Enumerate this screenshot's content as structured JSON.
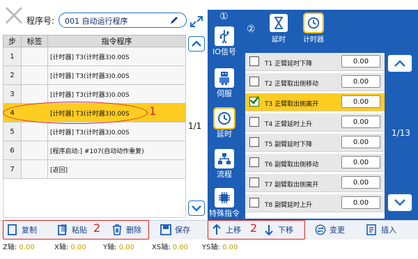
{
  "header": {
    "program_label": "程序号:",
    "program_value": "001 自动运行程序"
  },
  "program_table": {
    "columns": [
      "步",
      "标签",
      "指令程序"
    ],
    "rows": [
      {
        "step": "1",
        "tag": "",
        "instruction": "[计时器] T3(计时器3)0.00S"
      },
      {
        "step": "2",
        "tag": "",
        "instruction": "[计时器] T3(计时器3)0.00S"
      },
      {
        "step": "3",
        "tag": "",
        "instruction": "[计时器] T3(计时器3)0.00S"
      },
      {
        "step": "4",
        "tag": "",
        "instruction": "[计时器] T3(计时器3)0.00S"
      },
      {
        "step": "5",
        "tag": "",
        "instruction": "[计时器] T3(计时器3)0.00S"
      },
      {
        "step": "6",
        "tag": "",
        "instruction": "[程序启动:] #107(自动动作重复)"
      },
      {
        "step": "7",
        "tag": "",
        "instruction": "[返回]"
      }
    ],
    "selected_step": "4",
    "page_indicator": "1/1"
  },
  "annotations": {
    "circle1": "①",
    "circle2": "②",
    "marker_row": "1",
    "marker_toolbar_left": "2",
    "marker_toolbar_mid": "2"
  },
  "categories": [
    {
      "label": "IO信号",
      "icon": "usb-icon"
    },
    {
      "label": "伺服",
      "icon": "robot-icon"
    },
    {
      "label": "延时",
      "icon": "clock-icon"
    },
    {
      "label": "流程",
      "icon": "flow-icon"
    },
    {
      "label": "特殊指令",
      "icon": "chip-icon"
    }
  ],
  "sub_tabs": [
    {
      "label": "延时",
      "icon": "hourglass-icon"
    },
    {
      "label": "计时器",
      "icon": "clock-icon"
    }
  ],
  "timers": [
    {
      "label": "T1  正臂延时下降",
      "value": "0.00",
      "checked": false
    },
    {
      "label": "T2  正臂取出侧移动",
      "value": "0.00",
      "checked": false
    },
    {
      "label": "T3  正臂取出侧离开",
      "value": "0.00",
      "checked": true
    },
    {
      "label": "T4  正臂延时上升",
      "value": "0.00",
      "checked": false
    },
    {
      "label": "T5  副臂延时下降",
      "value": "0.00",
      "checked": false
    },
    {
      "label": "T6  副臂取出侧移动",
      "value": "0.00",
      "checked": false
    },
    {
      "label": "T7  副臂取出侧离开",
      "value": "0.00",
      "checked": false
    },
    {
      "label": "T8  副臂延时上升",
      "value": "0.00",
      "checked": false
    }
  ],
  "timer_page_indicator": "1/13",
  "toolbar": {
    "copy": "复制",
    "paste": "粘贴",
    "delete": "删除",
    "save": "保存",
    "move_up": "上移",
    "move_down": "下移",
    "change": "变更",
    "insert": "插入"
  },
  "status": {
    "z_label": "Z轴:",
    "z_value": "0.00",
    "x_label": "X轴:",
    "x_value": "0.00",
    "y_label": "Y轴:",
    "y_value": "0.00",
    "xs_label": "XS轴:",
    "xs_value": "0.00",
    "ys_label": "YS轴:",
    "ys_value": "0.00"
  },
  "colors": {
    "accent_blue": "#1d5eb7",
    "selected_row": "#ffcc22",
    "annotation_red": "#e02020"
  }
}
